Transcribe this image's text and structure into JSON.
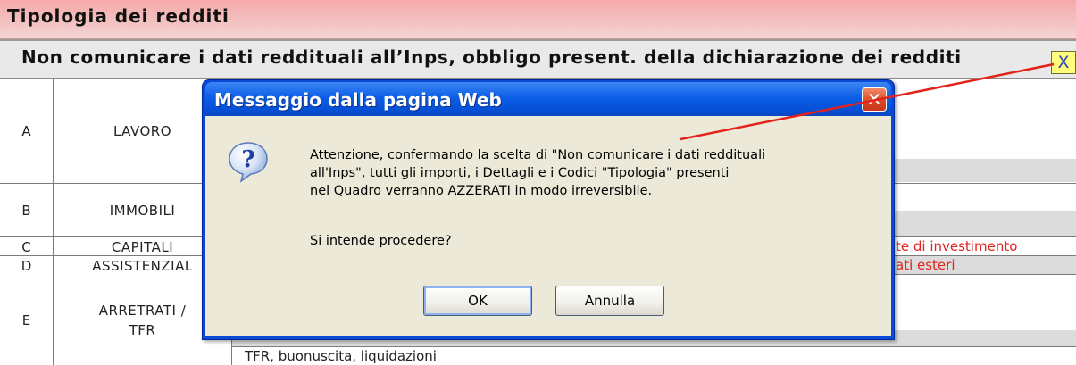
{
  "form": {
    "section_title": "Tipologia dei redditi",
    "warning_label": "Non comunicare i dati reddituali all’Inps, obbligo present. della dichiarazione dei redditi",
    "checkbox_value": "X",
    "rows": [
      {
        "letter": "A",
        "category": "LAVORO"
      },
      {
        "letter": "B",
        "category": "IMMOBILI"
      },
      {
        "letter": "C",
        "category": "CAPITALI",
        "detail_visible": "te di investimento"
      },
      {
        "letter": "D",
        "category": "ASSISTENZIAL",
        "detail_visible": "ati esteri"
      },
      {
        "letter": "E",
        "category_line1": "ARRETRATI /",
        "category_line2": "TFR",
        "detail_visible": "TFR, buonuscita, liquidazioni"
      }
    ]
  },
  "dialog": {
    "title": "Messaggio dalla pagina Web",
    "close_glyph": "✕",
    "icon": "question-icon",
    "message_lines": [
      "Attenzione, confermando la scelta di \"Non comunicare i dati reddituali",
      "all'Inps\", tutti gli importi, i Dettagli e i Codici \"Tipologia\" presenti",
      "nel Quadro verranno AZZERATI in modo irreversibile."
    ],
    "question": "Si intende procedere?",
    "ok_label": "OK",
    "cancel_label": "Annulla"
  },
  "colors": {
    "dialog_title": "#0c5ee8",
    "close_button": "#db4a22",
    "annotation": "#e3221b",
    "checkbox_bg": "#fffd7a"
  }
}
